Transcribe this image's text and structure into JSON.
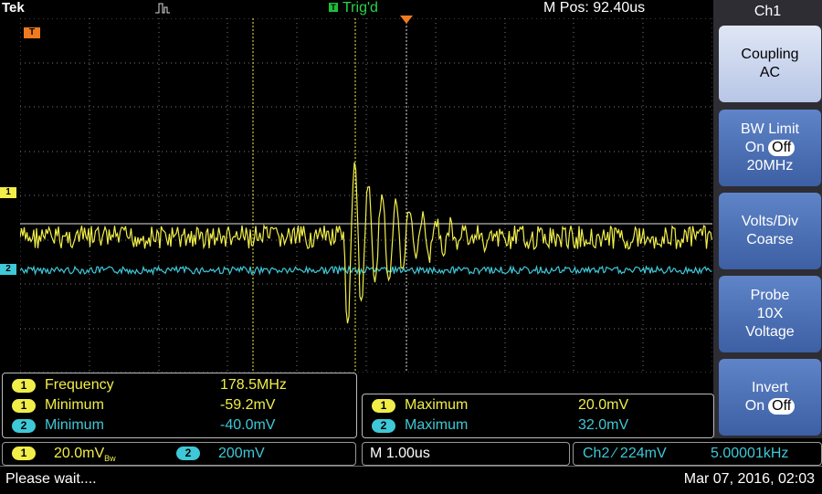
{
  "header": {
    "brand": "Tek",
    "trigger_badge": "T",
    "trigger_status": "Trig'd",
    "mpos": "M Pos: 92.40us"
  },
  "markers": {
    "trigger_pos": "T",
    "ch1": "1",
    "ch2": "2"
  },
  "side_menu": {
    "title": "Ch1",
    "coupling": {
      "line1": "Coupling",
      "line2": "AC"
    },
    "bw_limit": {
      "line1": "BW Limit",
      "on": "On",
      "off": "Off",
      "line3": "20MHz"
    },
    "volts_div": {
      "line1": "Volts/Div",
      "line2": "Coarse"
    },
    "probe": {
      "line1": "Probe",
      "line2": "10X",
      "line3": "Voltage"
    },
    "invert": {
      "line1": "Invert",
      "on": "On",
      "off": "Off"
    }
  },
  "measurements_left": [
    {
      "ch": "1",
      "name": "Frequency",
      "value": "178.5MHz"
    },
    {
      "ch": "1",
      "name": "Minimum",
      "value": "-59.2mV"
    },
    {
      "ch": "2",
      "name": "Minimum",
      "value": "-40.0mV"
    }
  ],
  "measurements_right": [
    {
      "ch": "1",
      "name": "Maximum",
      "value": "20.0mV"
    },
    {
      "ch": "2",
      "name": "Maximum",
      "value": "32.0mV"
    }
  ],
  "bottom": {
    "ch1_badge": "1",
    "ch1_scale": "20.0mV",
    "ch1_bw": "Bw",
    "ch2_badge": "2",
    "ch2_scale": "200mV",
    "timebase": "M 1.00us",
    "trigger_info": "Ch2 ⁄ 224mV",
    "trigger_freq": "5.00001kHz"
  },
  "status": {
    "message": "Please wait....",
    "datetime": "Mar 07, 2016, 02:03"
  },
  "colors": {
    "ch1": "#f1ee4a",
    "ch2": "#3ec8d8",
    "grid": "#8a8a8a",
    "trigger": "#2bd24a",
    "menu_button": "#4d70b8"
  }
}
